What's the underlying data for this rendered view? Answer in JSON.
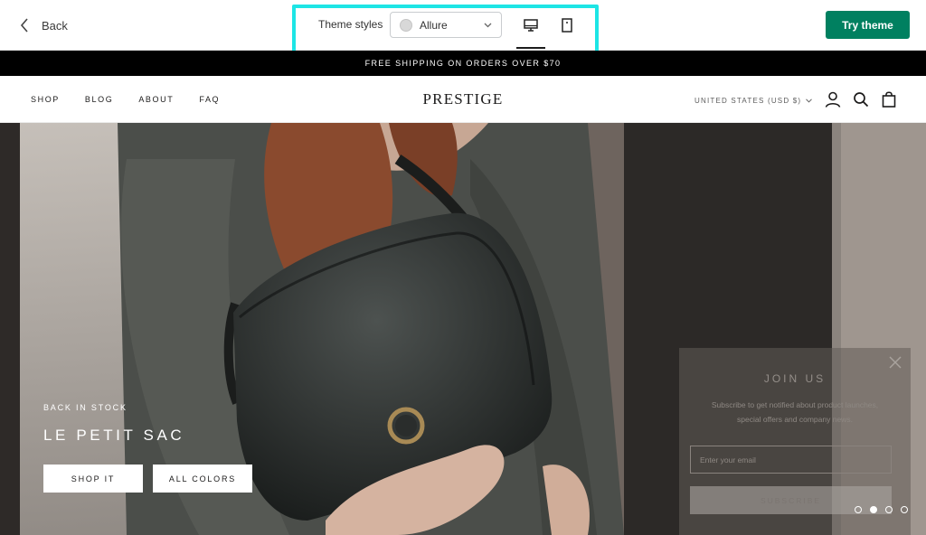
{
  "editor": {
    "back_label": "Back",
    "theme_styles_label": "Theme styles",
    "style_select": {
      "value": "Allure"
    },
    "preview_modes": [
      "desktop",
      "mobile"
    ],
    "active_mode": "desktop",
    "try_button_label": "Try theme",
    "colors": {
      "primary": "#008060",
      "highlight": "#1de5e5"
    }
  },
  "store": {
    "announcement": "FREE SHIPPING ON ORDERS OVER $70",
    "nav": [
      "SHOP",
      "BLOG",
      "ABOUT",
      "FAQ"
    ],
    "brand": "PRESTIGE",
    "currency": "UNITED STATES (USD $)",
    "header_icons": [
      "account-icon",
      "search-icon",
      "cart-icon"
    ]
  },
  "hero": {
    "subtitle": "BACK IN STOCK",
    "title": "LE PETIT SAC",
    "buttons": [
      "SHOP IT",
      "ALL COLORS"
    ],
    "slide_count": 4,
    "active_slide": 2
  },
  "newsletter": {
    "title": "JOIN US",
    "text_line1": "Subscribe to get notified about product launches,",
    "text_line2": "special offers and company news.",
    "email_placeholder": "Enter your email",
    "submit_label": "SUBSCRIBE"
  }
}
